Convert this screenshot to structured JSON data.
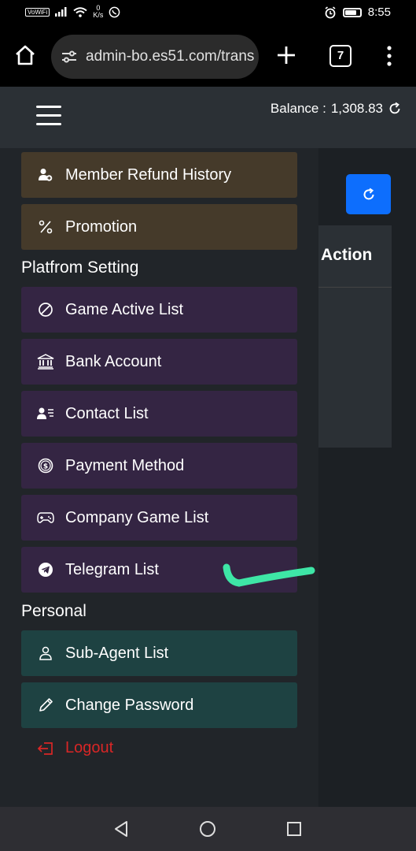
{
  "status_bar": {
    "wifi_tag": "VoWiFi",
    "speed_value": "0",
    "speed_unit": "K/s",
    "time": "8:55",
    "battery_level": 0.8
  },
  "browser": {
    "url": "admin-bo.es51.com/trans",
    "tab_count": "7"
  },
  "header": {
    "balance_label": "Balance :",
    "balance_value": "1,308.83"
  },
  "page": {
    "action_header": "Action"
  },
  "sidebar": {
    "top_items": [
      {
        "label": "Member Refund History",
        "icon": "user-plus-icon"
      },
      {
        "label": "Promotion",
        "icon": "percent-icon"
      }
    ],
    "platform_section": "Platfrom Setting",
    "platform_items": [
      {
        "label": "Game Active List",
        "icon": "circle-slash-icon"
      },
      {
        "label": "Bank Account",
        "icon": "bank-icon"
      },
      {
        "label": "Contact List",
        "icon": "contact-list-icon"
      },
      {
        "label": "Payment Method",
        "icon": "dollar-coin-icon"
      },
      {
        "label": "Company Game List",
        "icon": "gamepad-icon"
      },
      {
        "label": "Telegram List",
        "icon": "telegram-icon"
      }
    ],
    "personal_section": "Personal",
    "personal_items": [
      {
        "label": "Sub-Agent List",
        "icon": "person-icon"
      },
      {
        "label": "Change Password",
        "icon": "pencil-icon"
      }
    ],
    "logout_label": "Logout"
  },
  "colors": {
    "brown_item": "#453a2a",
    "purple_item": "#342543",
    "teal_item": "#1e4242",
    "logout": "#d92626",
    "primary_button": "#0d6efd",
    "check_mark": "#3ee6a6"
  }
}
